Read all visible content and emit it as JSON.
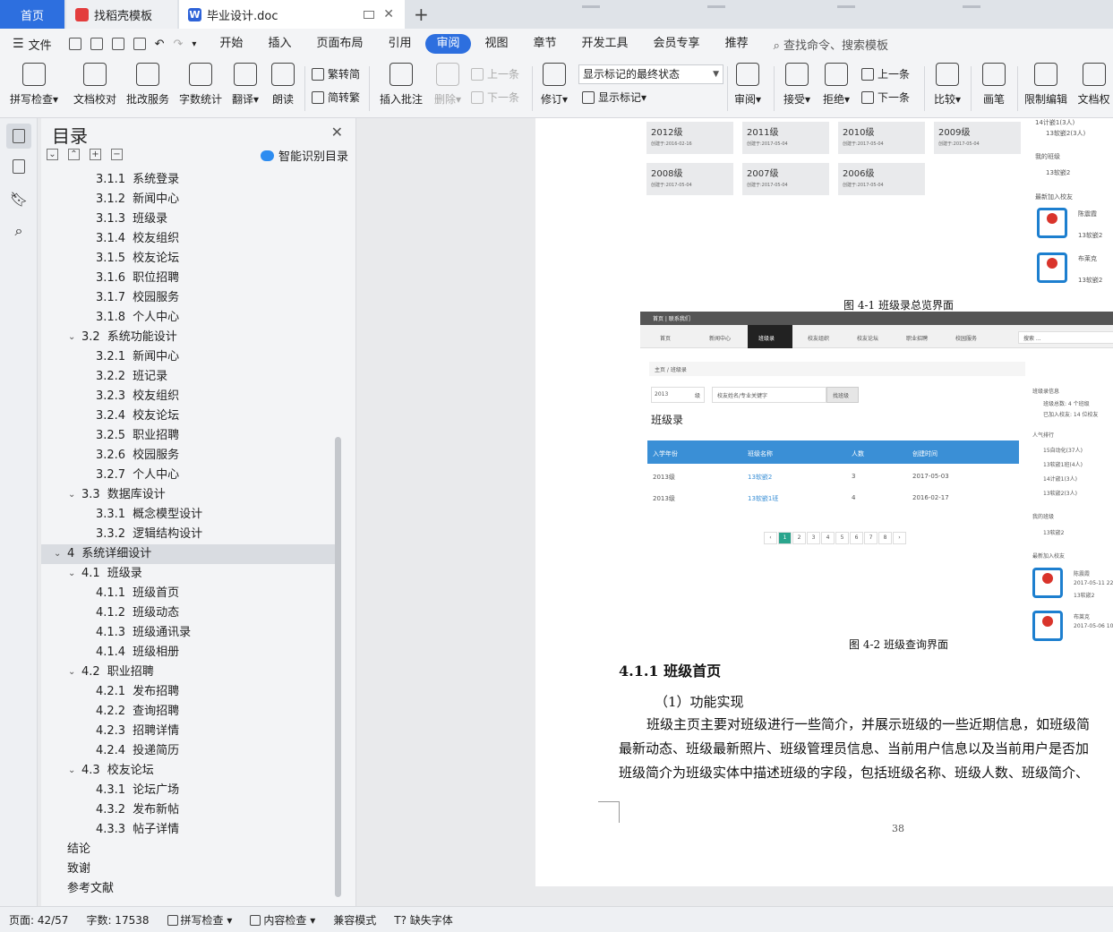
{
  "tabs": {
    "home": "首页",
    "template": "找稻壳模板",
    "doc": "毕业设计.doc"
  },
  "menu": {
    "file": "文件",
    "items": [
      "开始",
      "插入",
      "页面布局",
      "引用",
      "审阅",
      "视图",
      "章节",
      "开发工具",
      "会员专享",
      "推荐"
    ],
    "active": "审阅",
    "search": "查找命令、搜索模板"
  },
  "ribbon": {
    "spell_check": "拼写检查",
    "doc_proof": "文档校对",
    "correction": "批改服务",
    "word_count": "字数统计",
    "translate": "翻译",
    "read_aloud": "朗读",
    "trad_to_simp": "繁转简",
    "simp_to_trad": "简转繁",
    "insert_comment": "插入批注",
    "delete": "删除",
    "prev": "上一条",
    "next": "下一条",
    "revise": "修订",
    "markup_state": "显示标记的最终状态",
    "show_markup": "显示标记",
    "review": "审阅",
    "accept": "接受",
    "reject": "拒绝",
    "prev2": "上一条",
    "next2": "下一条",
    "compare": "比较",
    "pen": "画笔",
    "restrict": "限制编辑",
    "doc_perm": "文档权"
  },
  "toc": {
    "title": "目录",
    "smart": "智能识别目录",
    "items": [
      {
        "level": 3,
        "num": "3.1.1",
        "text": "系统登录"
      },
      {
        "level": 3,
        "num": "3.1.2",
        "text": "新闻中心"
      },
      {
        "level": 3,
        "num": "3.1.3",
        "text": "班级录"
      },
      {
        "level": 3,
        "num": "3.1.4",
        "text": "校友组织"
      },
      {
        "level": 3,
        "num": "3.1.5",
        "text": "校友论坛"
      },
      {
        "level": 3,
        "num": "3.1.6",
        "text": "职位招聘"
      },
      {
        "level": 3,
        "num": "3.1.7",
        "text": "校园服务"
      },
      {
        "level": 3,
        "num": "3.1.8",
        "text": "个人中心"
      },
      {
        "level": 2,
        "num": "3.2",
        "text": "系统功能设计"
      },
      {
        "level": 3,
        "num": "3.2.1",
        "text": "新闻中心"
      },
      {
        "level": 3,
        "num": "3.2.2",
        "text": "班记录"
      },
      {
        "level": 3,
        "num": "3.2.3",
        "text": "校友组织"
      },
      {
        "level": 3,
        "num": "3.2.4",
        "text": "校友论坛"
      },
      {
        "level": 3,
        "num": "3.2.5",
        "text": "职业招聘"
      },
      {
        "level": 3,
        "num": "3.2.6",
        "text": "校园服务"
      },
      {
        "level": 3,
        "num": "3.2.7",
        "text": "个人中心"
      },
      {
        "level": 2,
        "num": "3.3",
        "text": "数据库设计"
      },
      {
        "level": 3,
        "num": "3.3.1",
        "text": "概念模型设计"
      },
      {
        "level": 3,
        "num": "3.3.2",
        "text": "逻辑结构设计"
      },
      {
        "level": 1,
        "num": "4",
        "text": "系统详细设计"
      },
      {
        "level": 2,
        "num": "4.1",
        "text": "班级录"
      },
      {
        "level": 3,
        "num": "4.1.1",
        "text": "班级首页"
      },
      {
        "level": 3,
        "num": "4.1.2",
        "text": "班级动态"
      },
      {
        "level": 3,
        "num": "4.1.3",
        "text": "班级通讯录"
      },
      {
        "level": 3,
        "num": "4.1.4",
        "text": "班级相册"
      },
      {
        "level": 2,
        "num": "4.2",
        "text": "职业招聘"
      },
      {
        "level": 3,
        "num": "4.2.1",
        "text": "发布招聘"
      },
      {
        "level": 3,
        "num": "4.2.2",
        "text": "查询招聘"
      },
      {
        "level": 3,
        "num": "4.2.3",
        "text": "招聘详情"
      },
      {
        "level": 3,
        "num": "4.2.4",
        "text": "投递简历"
      },
      {
        "level": 2,
        "num": "4.3",
        "text": "校友论坛"
      },
      {
        "level": 3,
        "num": "4.3.1",
        "text": "论坛广场"
      },
      {
        "level": 3,
        "num": "4.3.2",
        "text": "发布新帖"
      },
      {
        "level": 3,
        "num": "4.3.3",
        "text": "帖子详情"
      },
      {
        "level": 1,
        "num": "",
        "text": "结论"
      },
      {
        "level": 1,
        "num": "",
        "text": "致谢"
      },
      {
        "level": 1,
        "num": "",
        "text": "参考文献"
      }
    ],
    "selected_index": 19
  },
  "doc": {
    "fig1": {
      "grades": [
        {
          "year": "2012级",
          "date": "创建于:2016-02-16"
        },
        {
          "year": "2011级",
          "date": "创建于:2017-05-04"
        },
        {
          "year": "2010级",
          "date": "创建于:2017-05-04"
        },
        {
          "year": "2009级",
          "date": "创建于:2017-05-04"
        },
        {
          "year": "2008级",
          "date": "创建于:2017-05-04"
        },
        {
          "year": "2007级",
          "date": "创建于:2017-05-04"
        },
        {
          "year": "2006级",
          "date": "创建于:2017-05-04"
        }
      ],
      "side": {
        "c1": "13软嵌2(3人)",
        "my_class": "我的班级",
        "c2": "13软嵌2",
        "new_alumni": "最新加入校友",
        "a1": "陈震霞",
        "a1c": "13软嵌2",
        "a2": "布莱克",
        "a2c": "13软嵌2"
      },
      "caption": "图 4-1  班级录总览界面"
    },
    "fig2": {
      "topbar": "首页 | 联系我们",
      "nav": [
        "首页",
        "新闻中心",
        "班级录",
        "校友组织",
        "校友论坛",
        "职业招聘",
        "校园服务"
      ],
      "search": "搜索 ...",
      "breadcrumb": "主页 / 班级录",
      "year": "2013",
      "year_suffix": "级",
      "keyword": "校友姓名/专业关键字",
      "find": "找班级",
      "heading": "班级录",
      "table_headers": [
        "入学年份",
        "班级名称",
        "人数",
        "创建时间"
      ],
      "rows": [
        [
          "2013级",
          "13软嵌2",
          "3",
          "2017-05-03"
        ],
        [
          "2013级",
          "13软嵌1班",
          "4",
          "2016-02-17"
        ]
      ],
      "pages": [
        "‹",
        "1",
        "2",
        "3",
        "4",
        "5",
        "6",
        "7",
        "8",
        "›"
      ],
      "side": {
        "info": "班级录信息",
        "total": "班级总数: 4 个班级",
        "joined": "已加入校友: 14 位校友",
        "rank": "人气排行",
        "r": [
          "15自动化(37人)",
          "13软嵌1班(4人)",
          "14计嵌1(3人)",
          "13软嵌2(3人)"
        ],
        "my_class": "我的班级",
        "mc": "13软嵌2",
        "new_alumni": "最新加入校友",
        "a1": "陈震霞",
        "a1d": "2017-05-11 22:1",
        "a1c": "13软嵌2",
        "a2": "布莱克",
        "a2d": "2017-05-06 10:2"
      },
      "caption": "图 4-2  班级查询界面"
    },
    "heading": "4.1.1  班级首页",
    "p1": "（1）功能实现",
    "p2": "班级主页主要对班级进行一些简介，并展示班级的一些近期信息，如班级简",
    "p3": "最新动态、班级最新照片、班级管理员信息、当前用户信息以及当前用户是否加",
    "p4": "班级简介为班级实体中描述班级的字段，包括班级名称、班级人数、班级简介、",
    "page_number": "38"
  },
  "status": {
    "page": "页面: 42/57",
    "words": "字数: 17538",
    "spell": "拼写检查",
    "content": "内容检查",
    "compat": "兼容模式",
    "missing_font": "缺失字体"
  }
}
